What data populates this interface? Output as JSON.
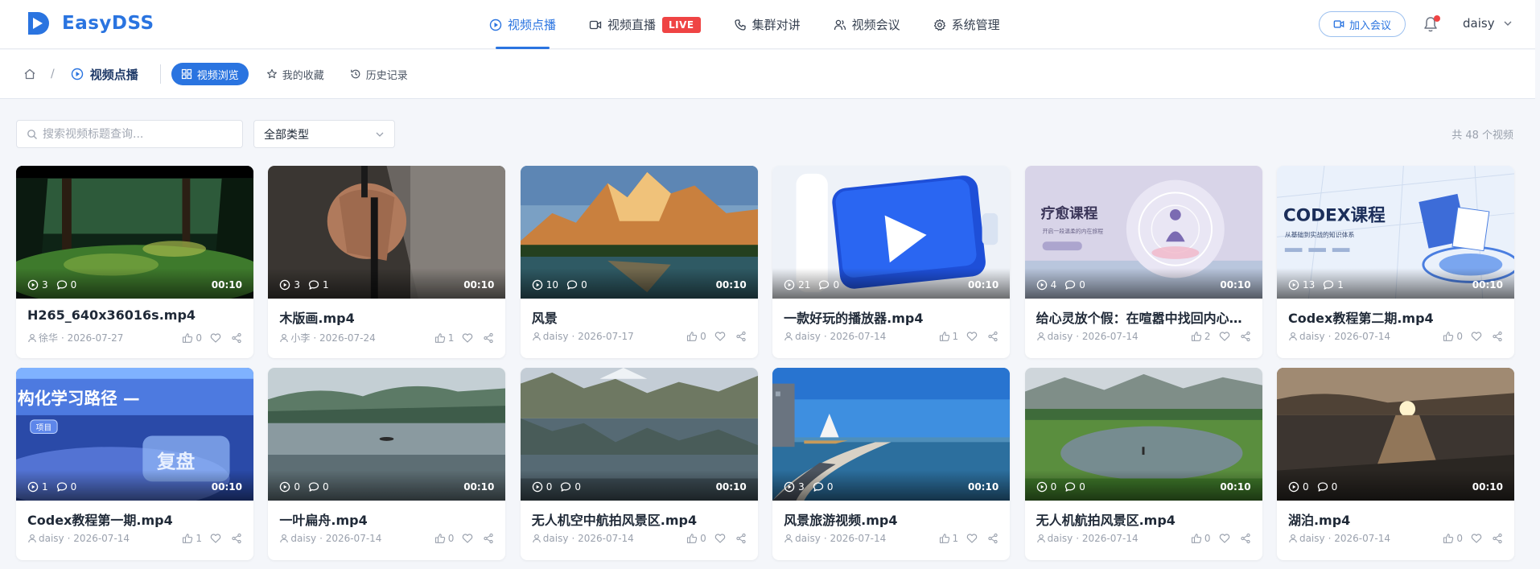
{
  "brand": {
    "name": "EasyDSS",
    "color": "#2a74e0"
  },
  "nav": [
    {
      "label": "视频点播",
      "icon": "play-circle-icon",
      "active": true
    },
    {
      "label": "视频直播",
      "icon": "video-camera-icon",
      "badge": "LIVE"
    },
    {
      "label": "集群对讲",
      "icon": "phone-icon"
    },
    {
      "label": "视频会议",
      "icon": "users-icon"
    },
    {
      "label": "系统管理",
      "icon": "gear-icon"
    }
  ],
  "header": {
    "join_label": "加入会议",
    "user_name": "daisy"
  },
  "subnav": {
    "module": "视频点播",
    "separator": "/",
    "tabs": [
      {
        "label": "视频浏览",
        "active": true
      },
      {
        "label": "我的收藏"
      },
      {
        "label": "历史记录"
      }
    ]
  },
  "filters": {
    "search_placeholder": "搜索视频标题查询...",
    "search_value": "",
    "type_selected": "全部类型",
    "total_text": "共 48 个视频"
  },
  "videos": [
    {
      "title": "H265_640x36016s.mp4",
      "author": "徐华",
      "date": "2026-07-27",
      "likes": "0",
      "plays": "3",
      "comments": "0",
      "duration": "00:10",
      "art": "forest"
    },
    {
      "title": "木版画.mp4",
      "author": "小李",
      "date": "2026-07-24",
      "likes": "1",
      "plays": "3",
      "comments": "1",
      "duration": "00:10",
      "art": "hand"
    },
    {
      "title": "风景",
      "author": "daisy",
      "date": "2026-07-17",
      "likes": "0",
      "plays": "10",
      "comments": "0",
      "duration": "00:10",
      "art": "mountain"
    },
    {
      "title": "一款好玩的播放器.mp4",
      "author": "daisy",
      "date": "2026-07-14",
      "likes": "1",
      "plays": "21",
      "comments": "0",
      "duration": "00:10",
      "art": "player"
    },
    {
      "title": "给心灵放个假：在喧嚣中找回内心的宁静",
      "author": "daisy",
      "date": "2026-07-14",
      "likes": "2",
      "plays": "4",
      "comments": "0",
      "duration": "00:10",
      "art": "meditation",
      "overlay_title": "疗愈课程",
      "overlay_sub": "开启一段温柔的内在旅程"
    },
    {
      "title": "Codex教程第二期.mp4",
      "author": "daisy",
      "date": "2026-07-14",
      "likes": "0",
      "plays": "13",
      "comments": "1",
      "duration": "00:10",
      "art": "codex",
      "overlay_title": "CODEX课程",
      "overlay_sub": "从基础到实战的知识体系"
    },
    {
      "title": "Codex教程第一期.mp4",
      "author": "daisy",
      "date": "2026-07-14",
      "likes": "1",
      "plays": "1",
      "comments": "0",
      "duration": "00:10",
      "art": "course",
      "overlay_title": "构化学习路径",
      "overlay_tag": "项目",
      "overlay_btn": "复盘"
    },
    {
      "title": "一叶扁舟.mp4",
      "author": "daisy",
      "date": "2026-07-14",
      "likes": "0",
      "plays": "0",
      "comments": "0",
      "duration": "00:10",
      "art": "boat"
    },
    {
      "title": "无人机空中航拍风景区.mp4",
      "author": "daisy",
      "date": "2026-07-14",
      "likes": "0",
      "plays": "0",
      "comments": "0",
      "duration": "00:10",
      "art": "lake"
    },
    {
      "title": "风景旅游视频.mp4",
      "author": "daisy",
      "date": "2026-07-14",
      "likes": "1",
      "plays": "3",
      "comments": "0",
      "duration": "00:10",
      "art": "seaside"
    },
    {
      "title": "无人机航拍风景区.mp4",
      "author": "daisy",
      "date": "2026-07-14",
      "likes": "0",
      "plays": "0",
      "comments": "0",
      "duration": "00:10",
      "art": "pond"
    },
    {
      "title": "湖泊.mp4",
      "author": "daisy",
      "date": "2026-07-14",
      "likes": "0",
      "plays": "0",
      "comments": "0",
      "duration": "00:10",
      "art": "sunset"
    }
  ]
}
